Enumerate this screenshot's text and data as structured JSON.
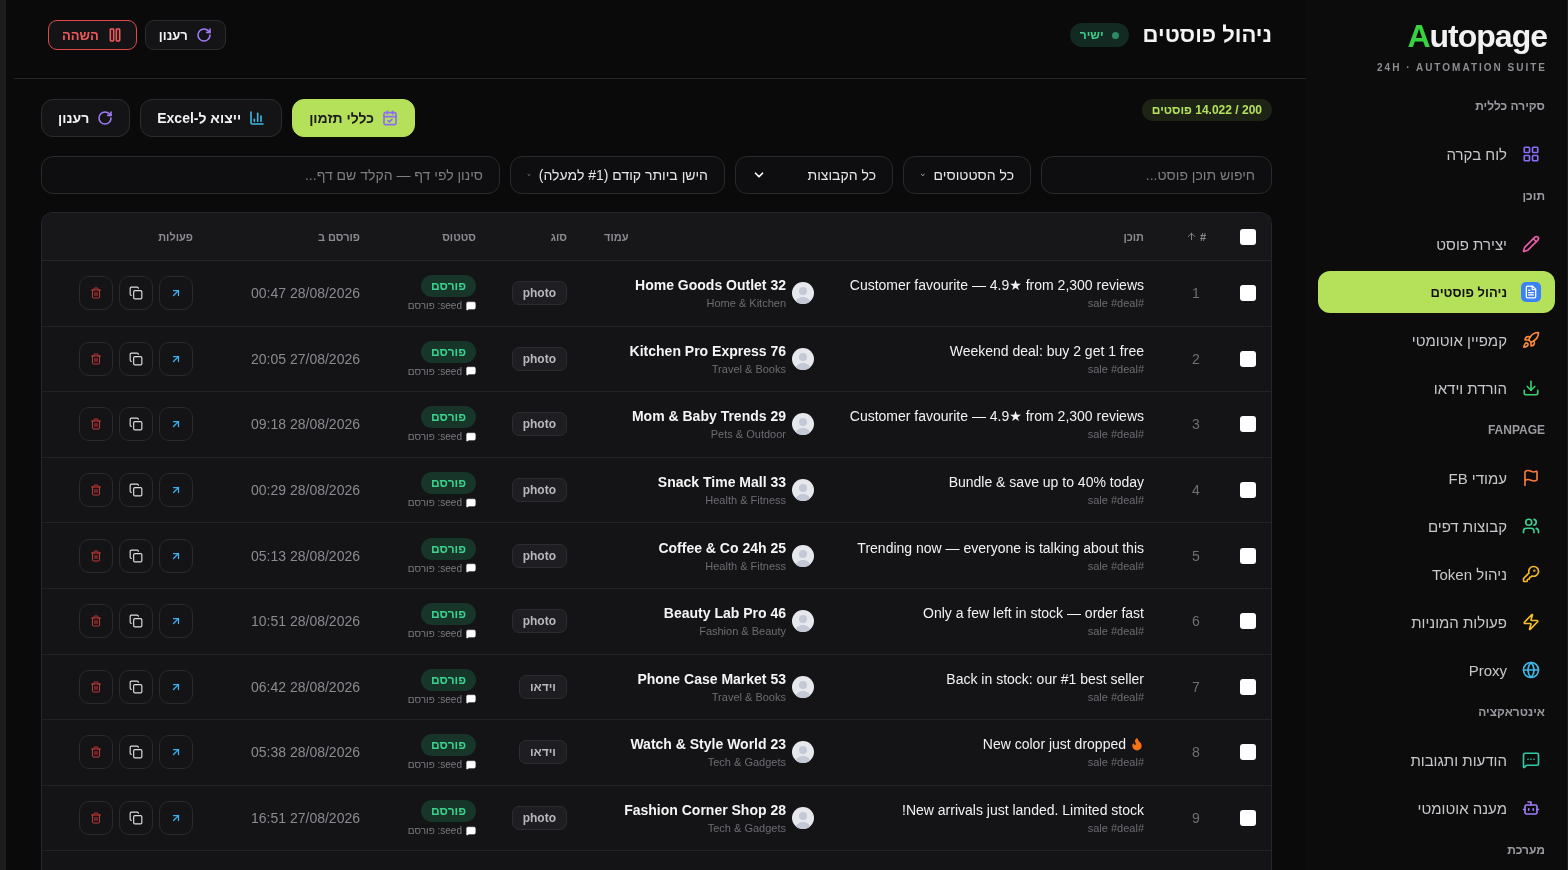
{
  "sidebar": {
    "logo": "Autopage",
    "tagline": "24H · AUTOMATION SUITE",
    "sections": [
      {
        "title": "סקירה כללית",
        "items": [
          {
            "label": "לוח בקרה",
            "kind": "grid",
            "selected": false
          }
        ]
      },
      {
        "title": "תוכן",
        "items": [
          {
            "label": "יצירת פוסט",
            "kind": "pencil",
            "selected": false
          },
          {
            "label": "ניהול פוסטים",
            "kind": "doc",
            "selected": true
          },
          {
            "label": "קמפיין אוטומטי",
            "kind": "rocket",
            "selected": false
          },
          {
            "label": "הורדת וידאו",
            "kind": "download",
            "selected": false
          }
        ]
      },
      {
        "title": "FANPAGE",
        "items": [
          {
            "label": "עמודי FB",
            "kind": "flag",
            "selected": false
          },
          {
            "label": "קבוצות דפים",
            "kind": "users",
            "selected": false
          },
          {
            "label": "ניהול Token",
            "kind": "key",
            "selected": false
          },
          {
            "label": "פעולות המוניות",
            "kind": "zap",
            "selected": false
          },
          {
            "label": "Proxy",
            "kind": "globe",
            "selected": false
          }
        ]
      },
      {
        "title": "אינטראקציה",
        "items": [
          {
            "label": "הודעות ותגובות",
            "kind": "message",
            "selected": false
          },
          {
            "label": "מענה אוטומטי",
            "kind": "bot",
            "selected": false
          }
        ]
      },
      {
        "title": "מערכת"
      }
    ]
  },
  "header": {
    "title": "ניהול פוסטים",
    "badge": "ישיר",
    "buttons": [
      {
        "label": "רענון",
        "kind": "refresh"
      },
      {
        "label": "השהה",
        "kind": "pause"
      }
    ]
  },
  "toolbar": {
    "count": "200 / 14.022 פוסטים",
    "buttons": [
      {
        "label": "כללי תזמון",
        "kind": "schedule"
      },
      {
        "label": "ייצוא ל-Excel",
        "kind": "export"
      },
      {
        "label": "רענון",
        "kind": "refresh"
      }
    ]
  },
  "filters": [
    {
      "kind": "search",
      "placeholder": "חיפוש תוכן פוסט..."
    },
    {
      "kind": "select",
      "value": "כל הסטטוסים"
    },
    {
      "kind": "select",
      "value": "כל הקבוצות"
    },
    {
      "kind": "select",
      "value": "הישן ביותר קודם (#1 למעלה)"
    },
    {
      "kind": "search",
      "placeholder": "סינון לפי דף — הקלד שם דף..."
    }
  ],
  "table": {
    "all_checked": false,
    "columns": [
      {
        "label": "#",
        "sorted": true
      },
      {
        "label": "תוכן",
        "sorted": false
      },
      {
        "label": "עמוד",
        "sorted": false
      },
      {
        "label": "סוג",
        "sorted": false
      },
      {
        "label": "סטטוס",
        "sorted": false
      },
      {
        "label": "פורסם ב",
        "sorted": false
      },
      {
        "label": "פעולות",
        "sorted": false
      }
    ],
    "rows": [
      {
        "checked": false,
        "number": "1",
        "content": "Customer favourite — 4.9★ from 2,300 reviews",
        "tags": "#sale #deal",
        "page": "Home Goods Outlet 32",
        "category": "Home & Kitchen",
        "type": "photo",
        "status": "פורסם",
        "status_note": "seed: פורסם",
        "published": "28/08/2026 00:47"
      },
      {
        "checked": false,
        "number": "2",
        "content": "Weekend deal: buy 2 get 1 free",
        "tags": "#sale #deal",
        "page": "Kitchen Pro Express 76",
        "category": "Travel & Books",
        "type": "photo",
        "status": "פורסם",
        "status_note": "seed: פורסם",
        "published": "27/08/2026 20:05"
      },
      {
        "checked": false,
        "number": "3",
        "content": "Customer favourite — 4.9★ from 2,300 reviews",
        "tags": "#sale #deal",
        "page": "Mom & Baby Trends 29",
        "category": "Pets & Outdoor",
        "type": "photo",
        "status": "פורסם",
        "status_note": "seed: פורסם",
        "published": "28/08/2026 09:18"
      },
      {
        "checked": false,
        "number": "4",
        "content": "Bundle & save up to 40% today",
        "tags": "#sale #deal",
        "page": "Snack Time Mall 33",
        "category": "Health & Fitness",
        "type": "photo",
        "status": "פורסם",
        "status_note": "seed: פורסם",
        "published": "28/08/2026 00:29"
      },
      {
        "checked": false,
        "number": "5",
        "content": "Trending now — everyone is talking about this",
        "tags": "#sale #deal",
        "page": "Coffee & Co 24h 25",
        "category": "Health & Fitness",
        "type": "photo",
        "status": "פורסם",
        "status_note": "seed: פורסם",
        "published": "28/08/2026 05:13"
      },
      {
        "checked": false,
        "number": "6",
        "content": "Only a few left in stock — order fast",
        "tags": "#sale #deal",
        "page": "Beauty Lab Pro 46",
        "category": "Fashion & Beauty",
        "type": "photo",
        "status": "פורסם",
        "status_note": "seed: פורסם",
        "published": "28/08/2026 10:51"
      },
      {
        "checked": false,
        "number": "7",
        "content": "Back in stock: our #1 best seller",
        "tags": "#sale #deal",
        "page": "Phone Case Market 53",
        "category": "Travel & Books",
        "type": "וידאו",
        "status": "פורסם",
        "status_note": "seed: פורסם",
        "published": "28/08/2026 06:42"
      },
      {
        "checked": false,
        "number": "8",
        "kind": "fire",
        "content": "New color just dropped",
        "tags": "#sale #deal",
        "page": "Watch & Style World 23",
        "category": "Tech & Gadgets",
        "type": "וידאו",
        "status": "פורסם",
        "status_note": "seed: פורסם",
        "published": "28/08/2026 05:38"
      },
      {
        "checked": false,
        "number": "9",
        "content": "New arrivals just landed. Limited stock!",
        "tags": "#sale #deal",
        "page": "Fashion Corner Shop 28",
        "category": "Tech & Gadgets",
        "type": "photo",
        "status": "פורסם",
        "status_note": "seed: פורסם",
        "published": "27/08/2026 16:51"
      }
    ]
  }
}
